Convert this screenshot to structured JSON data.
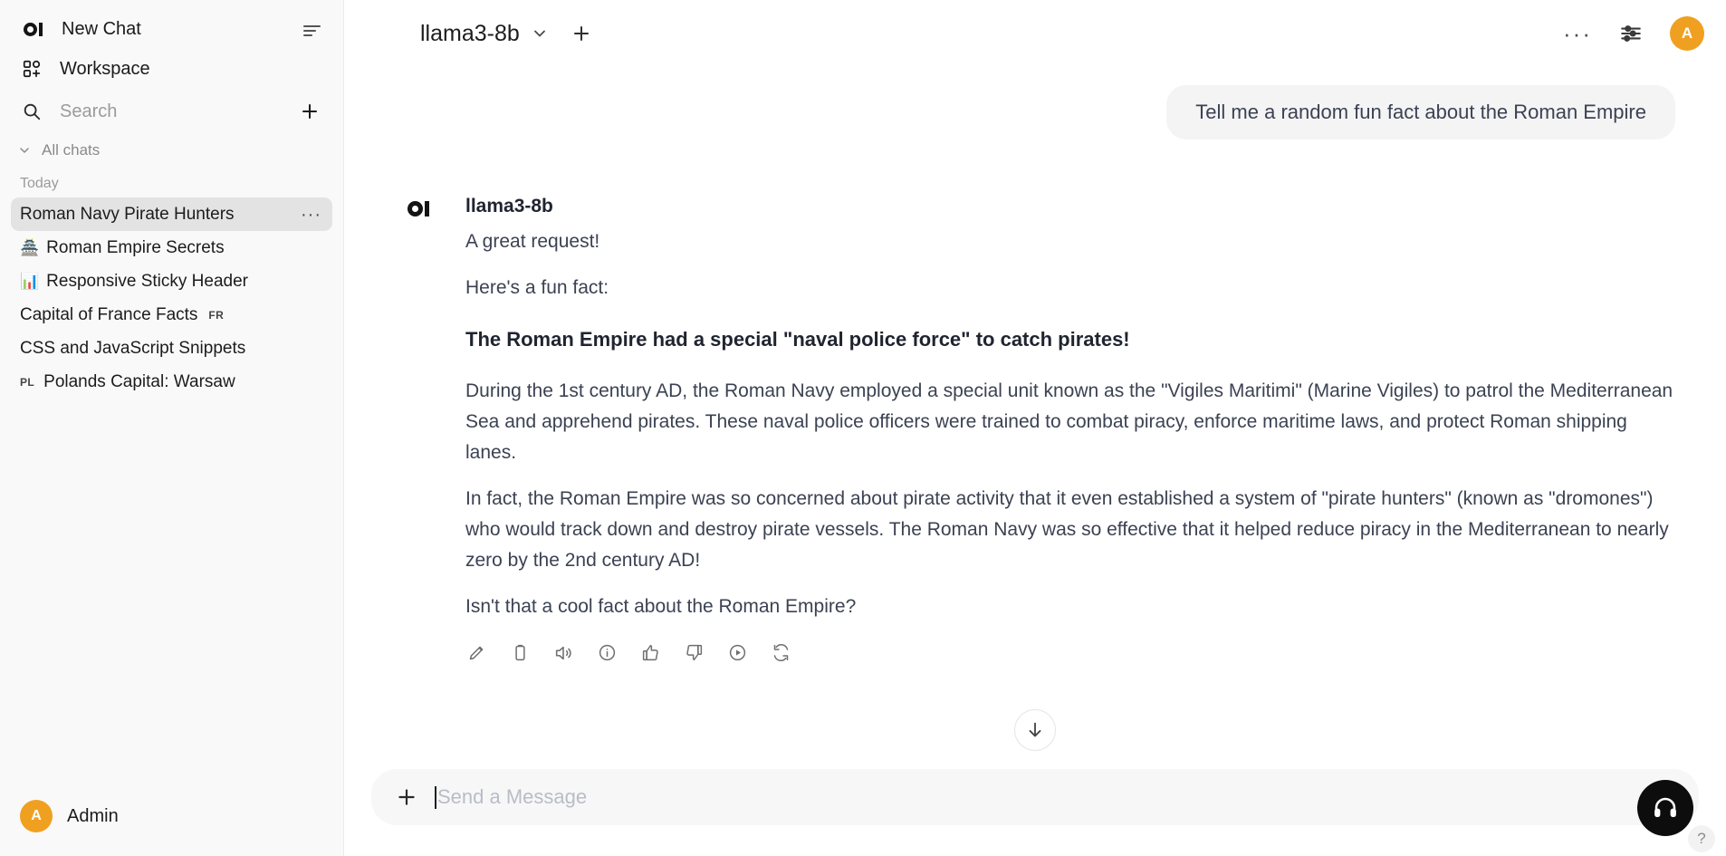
{
  "sidebar": {
    "new_chat_label": "New Chat",
    "workspace_label": "Workspace",
    "search_placeholder": "Search",
    "all_chats_label": "All chats",
    "day_label": "Today",
    "chats": [
      {
        "title": "Roman Navy Pirate Hunters",
        "emoji": "",
        "tag": "",
        "tag_position": "",
        "active": true
      },
      {
        "title": "Roman Empire Secrets",
        "emoji": "🏯",
        "tag": "",
        "tag_position": "",
        "active": false
      },
      {
        "title": "Responsive Sticky Header",
        "emoji": "📊",
        "tag": "",
        "tag_position": "",
        "active": false
      },
      {
        "title": "Capital of France Facts",
        "emoji": "",
        "tag": "FR",
        "tag_position": "after",
        "active": false
      },
      {
        "title": "CSS and JavaScript Snippets",
        "emoji": "",
        "tag": "",
        "tag_position": "",
        "active": false
      },
      {
        "title": "Polands Capital: Warsaw",
        "emoji": "",
        "tag": "PL",
        "tag_position": "before",
        "active": false
      }
    ],
    "row_menu_dots": "···",
    "user_name": "Admin",
    "user_initial": "A"
  },
  "topbar": {
    "model_name": "llama3-8b",
    "overflow_dots": "···",
    "avatar_initial": "A"
  },
  "conversation": {
    "user_message": "Tell me a random fun fact about the Roman Empire",
    "assistant_name": "llama3-8b",
    "assistant_paragraphs": [
      {
        "text": "A great request!",
        "bold": false
      },
      {
        "text": "Here's a fun fact:",
        "bold": false
      },
      {
        "text": "The Roman Empire had a special \"naval police force\" to catch pirates!",
        "bold": true
      },
      {
        "text": "During the 1st century AD, the Roman Navy employed a special unit known as the \"Vigiles Maritimi\" (Marine Vigiles) to patrol the Mediterranean Sea and apprehend pirates. These naval police officers were trained to combat piracy, enforce maritime laws, and protect Roman shipping lanes.",
        "bold": false
      },
      {
        "text": "In fact, the Roman Empire was so concerned about pirate activity that it even established a system of \"pirate hunters\" (known as \"dromones\") who would track down and destroy pirate vessels. The Roman Navy was so effective that it helped reduce piracy in the Mediterranean to nearly zero by the 2nd century AD!",
        "bold": false
      },
      {
        "text": "Isn't that a cool fact about the Roman Empire?",
        "bold": false
      }
    ],
    "action_icons": [
      "edit-icon",
      "copy-icon",
      "speaker-icon",
      "info-icon",
      "thumbs-up-icon",
      "thumbs-down-icon",
      "play-circle-icon",
      "regenerate-icon"
    ]
  },
  "composer": {
    "placeholder": "Send a Message",
    "value": "",
    "help_label": "?"
  },
  "colors": {
    "accent_orange": "#f0a020",
    "sidebar_bg": "#f9f9f9",
    "active_item": "#e3e3e3",
    "bubble_bg": "#f4f4f5",
    "text": "#3b4252"
  }
}
